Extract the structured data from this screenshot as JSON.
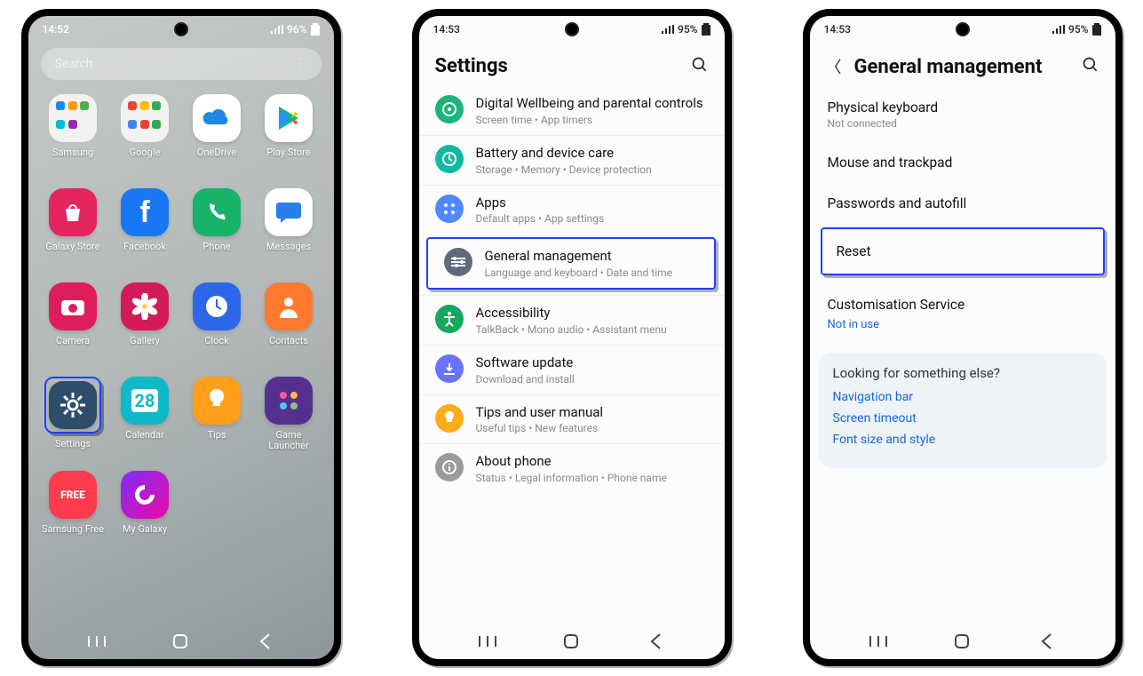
{
  "phone1": {
    "status": {
      "time": "14:52",
      "battery": "96%"
    },
    "search_placeholder": "Search",
    "apps": [
      {
        "label": "Samsung",
        "kind": "folder-samsung"
      },
      {
        "label": "Google",
        "kind": "folder-google"
      },
      {
        "label": "OneDrive",
        "bg": "#ffffff",
        "glyph": "cloud",
        "glyphColor": "#1e88e5"
      },
      {
        "label": "Play Store",
        "bg": "#ffffff",
        "glyph": "play"
      },
      {
        "label": "Galaxy Store",
        "bg": "#e6245e",
        "glyph": "bag",
        "glyphColor": "#fff"
      },
      {
        "label": "Facebook",
        "bg": "#1877f2",
        "glyph": "f",
        "glyphColor": "#fff"
      },
      {
        "label": "Phone",
        "bg": "#17b36a",
        "glyph": "phone",
        "glyphColor": "#fff"
      },
      {
        "label": "Messages",
        "bg": "#ffffff",
        "glyph": "bubble",
        "glyphColor": "#2b7de9"
      },
      {
        "label": "Camera",
        "bg": "#de1d5a",
        "glyph": "camera",
        "glyphColor": "#fff"
      },
      {
        "label": "Gallery",
        "bg": "#d31a5b",
        "glyph": "flower",
        "glyphColor": "#fff"
      },
      {
        "label": "Clock",
        "bg": "#2b67e8",
        "glyph": "clock",
        "glyphColor": "#fff"
      },
      {
        "label": "Contacts",
        "bg": "#ff7a2f",
        "glyph": "person",
        "glyphColor": "#fff"
      },
      {
        "label": "Settings",
        "bg": "#2e4d6b",
        "glyph": "gear",
        "glyphColor": "#fff",
        "highlight": true
      },
      {
        "label": "Calendar",
        "bg": "#0fb9c7",
        "glyph": "28",
        "glyphColor": "#fff"
      },
      {
        "label": "Tips",
        "bg": "#ff9f1a",
        "glyph": "bulb",
        "glyphColor": "#fff"
      },
      {
        "label": "Game Launcher",
        "bg": "#54318f",
        "glyph": "grid4",
        "glyphColor": "#ff5aa0"
      },
      {
        "label": "Samsung Free",
        "bg": "#ff3b4e",
        "glyph": "FREE",
        "glyphColor": "#fff"
      },
      {
        "label": "My Galaxy",
        "bg": "linear-gradient(135deg,#7b2ff7,#f107a3)",
        "glyph": "swirl",
        "glyphColor": "#fff"
      }
    ]
  },
  "phone2": {
    "status": {
      "time": "14:53",
      "battery": "95%"
    },
    "title": "Settings",
    "items": [
      {
        "title": "Digital Wellbeing and parental controls",
        "sub": "Screen time  •  App timers",
        "icon": "wellbeing",
        "bg": "#1db47b"
      },
      {
        "title": "Battery and device care",
        "sub": "Storage  •  Memory  •  Device protection",
        "icon": "care",
        "bg": "#10b9a0"
      },
      {
        "title": "Apps",
        "sub": "Default apps  •  App settings",
        "icon": "apps",
        "bg": "#4f88ff"
      },
      {
        "title": "General management",
        "sub": "Language and keyboard  •  Date and time",
        "icon": "sliders",
        "bg": "#5f6b7a",
        "highlight": true
      },
      {
        "title": "Accessibility",
        "sub": "TalkBack  •  Mono audio  •  Assistant menu",
        "icon": "a11y",
        "bg": "#17a85f"
      },
      {
        "title": "Software update",
        "sub": "Download and install",
        "icon": "update",
        "bg": "#6a73ff"
      },
      {
        "title": "Tips and user manual",
        "sub": "Useful tips  •  New features",
        "icon": "bulb",
        "bg": "#ffab1a"
      },
      {
        "title": "About phone",
        "sub": "Status  •  Legal information  •  Phone name",
        "icon": "info",
        "bg": "#9a9a9a"
      }
    ]
  },
  "phone3": {
    "status": {
      "time": "14:53",
      "battery": "95%"
    },
    "title": "General management",
    "items": [
      {
        "title": "Physical keyboard",
        "sub": "Not connected"
      },
      {
        "title": "Mouse and trackpad"
      },
      {
        "title": "Passwords and autofill"
      },
      {
        "title": "Reset",
        "highlight": true
      },
      {
        "title": "Customisation Service",
        "sublink": "Not in use"
      }
    ],
    "suggest": {
      "heading": "Looking for something else?",
      "links": [
        "Navigation bar",
        "Screen timeout",
        "Font size and style"
      ]
    }
  }
}
